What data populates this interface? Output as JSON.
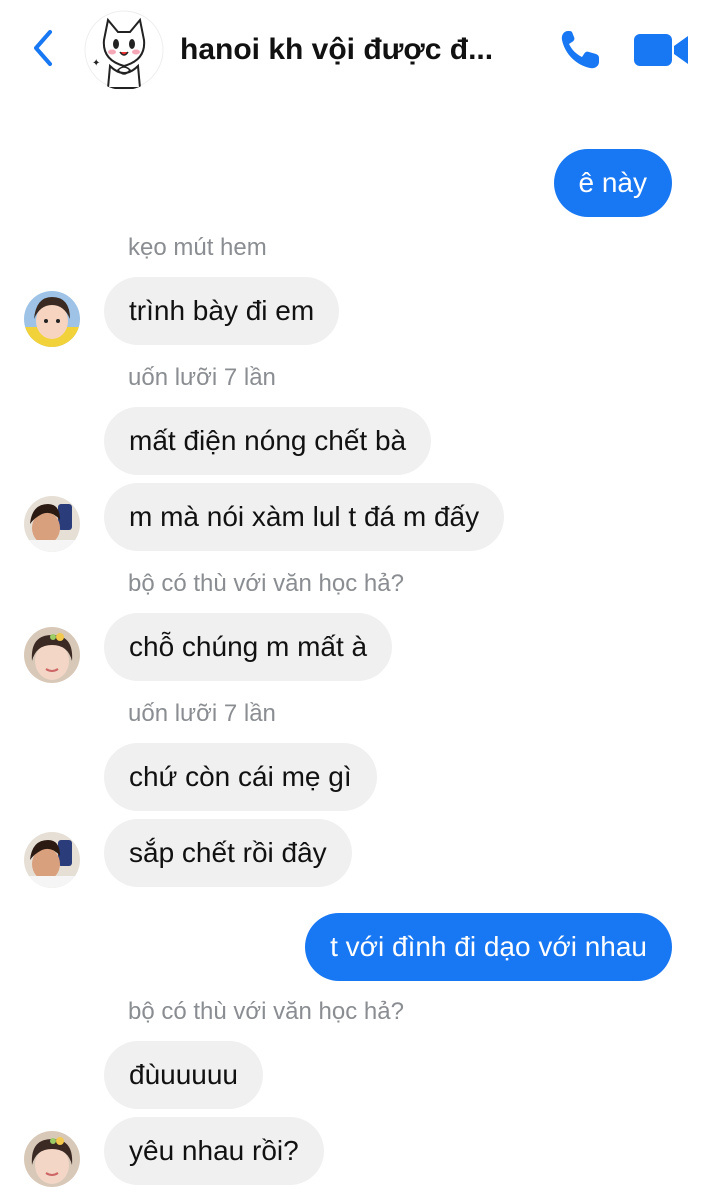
{
  "header": {
    "title": "hanoi kh vội được đ...",
    "back_icon": "chevron-left-icon",
    "call_icon": "phone-icon",
    "video_icon": "video-camera-icon",
    "accent_color": "#1877f2"
  },
  "messages": [
    {
      "text": "ê này"
    },
    {
      "sender": "kẹo mút hem",
      "text": "trình bày đi em"
    },
    {
      "sender": "uốn lưỡi 7 lần",
      "text": "mất điện nóng chết bà"
    },
    {
      "text": "m mà nói xàm lul t đá m đấy"
    },
    {
      "sender": "bộ có thù với văn học hả?",
      "text": "chỗ chúng m mất à"
    },
    {
      "sender": "uốn lưỡi 7 lần",
      "text": "chứ còn cái mẹ gì"
    },
    {
      "text": "sắp chết rồi đây"
    },
    {
      "text": "t với đình đi dạo với nhau"
    },
    {
      "sender": "bộ có thù với văn học hả?",
      "text": "đùuuuuu"
    },
    {
      "text": "yêu nhau rồi?"
    }
  ]
}
